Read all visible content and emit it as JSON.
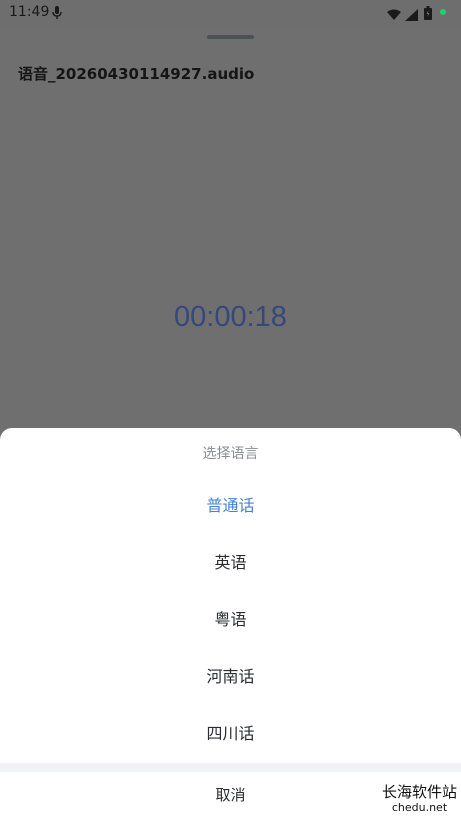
{
  "status_bar": {
    "time": "11:49",
    "icons": [
      "mic-icon",
      "wifi-icon",
      "signal-icon",
      "battery-icon",
      "status-dot"
    ]
  },
  "recording": {
    "file_name": "语音_20260430114927.audio",
    "elapsed": "00:00:18"
  },
  "language_dialog": {
    "title": "选择语言",
    "options": [
      {
        "label": "普通话",
        "selected": true
      },
      {
        "label": "英语",
        "selected": false
      },
      {
        "label": "粤语",
        "selected": false
      },
      {
        "label": "河南话",
        "selected": false
      },
      {
        "label": "四川话",
        "selected": false
      }
    ],
    "cancel_label": "取消"
  },
  "watermark": {
    "cn": "长海软件站",
    "en": "chedu.net"
  },
  "colors": {
    "accent": "#4a7ed8",
    "overlay": "#707070",
    "timer": "#34497a"
  }
}
